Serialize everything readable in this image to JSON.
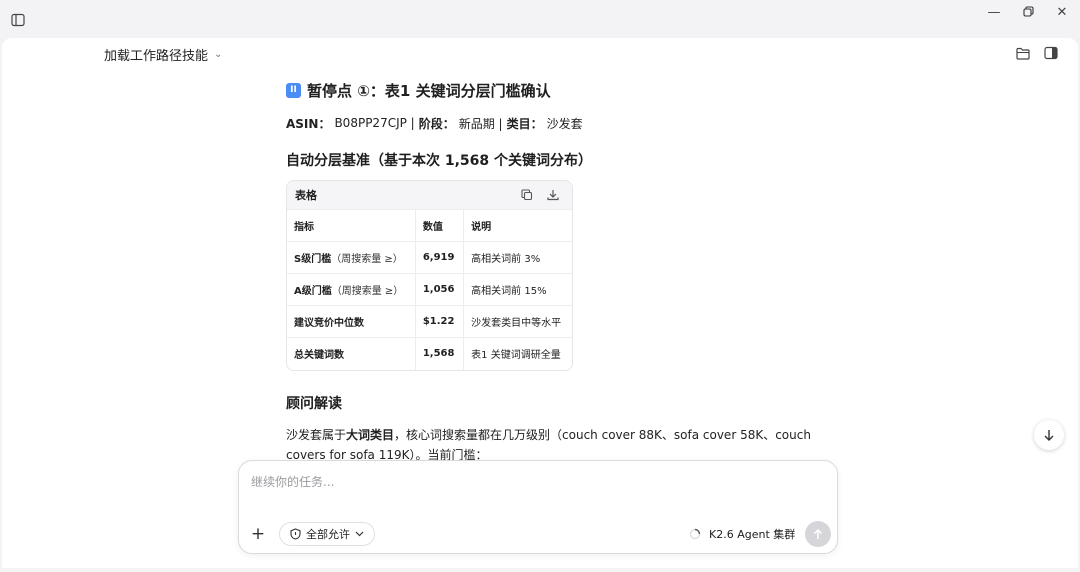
{
  "window": {
    "sidebar_toggle_icon": "sidebar-toggle-icon",
    "minimize_glyph": "—",
    "close_glyph": "✕"
  },
  "header": {
    "path_label": "加载工作路径技能",
    "path_chevron": "⌄"
  },
  "content": {
    "pause_badge": "II",
    "pause_title": "暂停点 ①：表1 关键词分层门槛确认",
    "meta": {
      "asin_label": "ASIN：",
      "asin_value": "B08PP27CJP |",
      "stage_label": "阶段：",
      "stage_value": "新品期 |",
      "category_label": "类目：",
      "category_value": "沙发套"
    },
    "basis_title": "自动分层基准（基于本次 1,568 个关键词分布）",
    "table": {
      "card_title": "表格",
      "headers": [
        "指标",
        "数值",
        "说明"
      ],
      "rows": [
        {
          "metric": "S级门槛",
          "metric_note": "（周搜索量 ≥）",
          "value": "6,919",
          "desc": "高相关词前 3%"
        },
        {
          "metric": "A级门槛",
          "metric_note": "（周搜索量 ≥）",
          "value": "1,056",
          "desc": "高相关词前 15%"
        },
        {
          "metric": "建议竞价中位数",
          "metric_note": "",
          "value": "$1.22",
          "desc": "沙发套类目中等水平"
        },
        {
          "metric": "总关键词数",
          "metric_note": "",
          "value": "1,568",
          "desc": "表1 关键词调研全量"
        }
      ]
    },
    "advisor_title": "顾问解读",
    "advisor_para": {
      "prefix": "沙发套属于",
      "bold": "大词类目",
      "suffix": "，核心词搜索量都在几万级别（couch cover 88K、sofa cover 58K、couch covers for sofa 119K）。当前门槛："
    }
  },
  "composer": {
    "placeholder": "继续你的任务...",
    "add_glyph": "+",
    "permission_label": "全部允许",
    "agent_label": "K2.6 Agent 集群"
  },
  "colors": {
    "accent": "#4a8ef5",
    "send_disabled": "#d6d6da"
  }
}
